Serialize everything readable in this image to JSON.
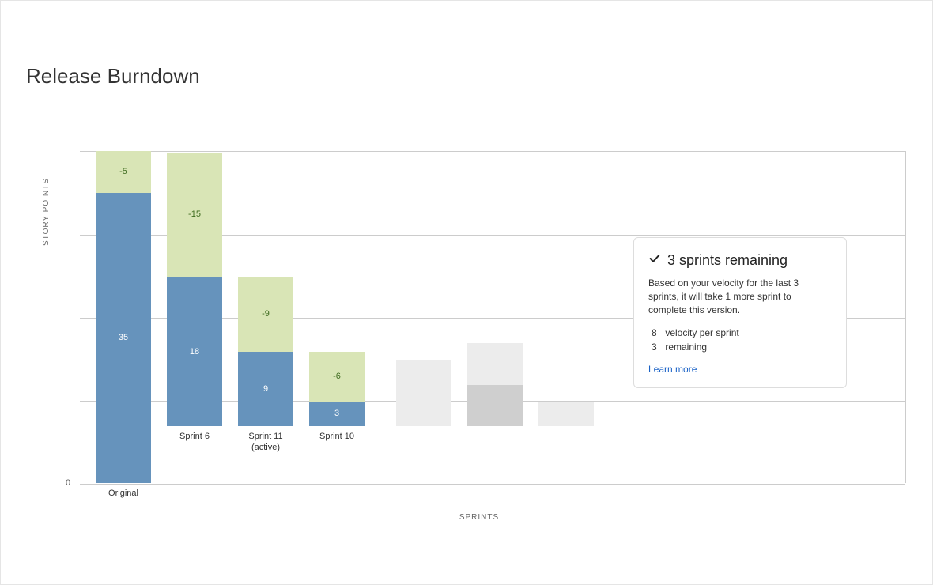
{
  "title": "Release Burndown",
  "ylabel": "STORY POINTS",
  "xlabel": "SPRINTS",
  "y_zero": "0",
  "chart_data": {
    "type": "bar",
    "ylabel": "STORY POINTS",
    "xlabel": "SPRINTS",
    "ylim": [
      0,
      40
    ],
    "series_meaning": {
      "remaining": "remaining story points (blue)",
      "completed": "completed in sprint, negative values shown in light-green on top"
    },
    "bars": [
      {
        "label": "Original",
        "remaining": 35,
        "completed": -5
      },
      {
        "label": "Sprint 6",
        "remaining": 18,
        "completed": -15
      },
      {
        "label": "Sprint 11 (active)",
        "remaining": 9,
        "completed": -9
      },
      {
        "label": "Sprint 10",
        "remaining": 3,
        "completed": -6
      }
    ],
    "forecast_bars": [
      {
        "remaining": 0,
        "completed": 8
      },
      {
        "remaining": 3,
        "completed": 8
      },
      {
        "remaining": 0,
        "completed": 3
      }
    ]
  },
  "bars": {
    "b0": {
      "label": "Original",
      "blue": "35",
      "green": "-5"
    },
    "b1": {
      "label": "Sprint 6",
      "blue": "18",
      "green": "-15"
    },
    "b2": {
      "label": "Sprint 11\n(active)",
      "blue": "9",
      "green": "-9"
    },
    "b3": {
      "label": "Sprint 10",
      "blue": "3",
      "green": "-6"
    }
  },
  "card": {
    "headline": "3 sprints remaining",
    "text": "Based on your velocity for the last 3 sprints, it will take 1 more sprint to complete this version.",
    "stat1_num": "8",
    "stat1_label": "velocity per sprint",
    "stat2_num": "3",
    "stat2_label": "remaining",
    "link": "Learn more"
  }
}
